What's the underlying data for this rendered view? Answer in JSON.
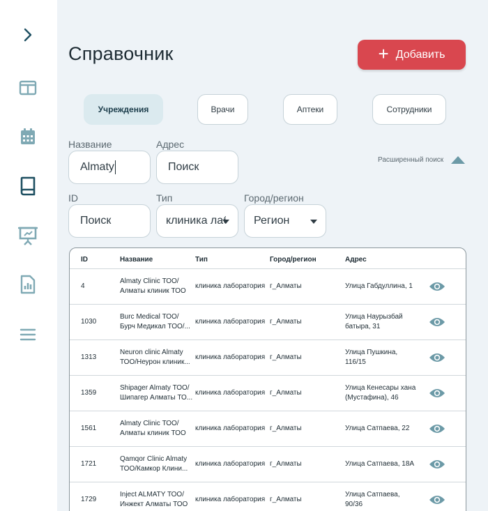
{
  "sidebar": {
    "items": [
      {
        "icon": "chevron-right-icon"
      },
      {
        "icon": "layout-icon"
      },
      {
        "icon": "calendar-icon"
      },
      {
        "icon": "book-icon"
      },
      {
        "icon": "presentation-icon"
      },
      {
        "icon": "report-icon"
      },
      {
        "icon": "menu-icon"
      }
    ]
  },
  "header": {
    "title": "Справочник",
    "add_label": "Добавить"
  },
  "tabs": [
    {
      "label": "Учреждения",
      "active": true
    },
    {
      "label": "Врачи",
      "active": false
    },
    {
      "label": "Аптеки",
      "active": false
    },
    {
      "label": "Сотрудники",
      "active": false
    }
  ],
  "filters": {
    "name": {
      "label": "Название",
      "value": "Almaty"
    },
    "address": {
      "label": "Адрес",
      "placeholder": "Поиск"
    },
    "id": {
      "label": "ID",
      "placeholder": "Поиск"
    },
    "type": {
      "label": "Тип",
      "value": "клиника лаборатория"
    },
    "city": {
      "label": "Город/регион",
      "value": "Регион"
    },
    "advanced_search": "Расширенный поиск"
  },
  "table": {
    "columns": [
      "ID",
      "Название",
      "Тип",
      "Город/регион",
      "Адрес"
    ],
    "rows": [
      {
        "id": "4",
        "name1": "Almaty Clinic ТОО/",
        "name2": "Алматы клиник ТОО",
        "type": "клиника лаборатория",
        "city": "г_Алматы",
        "addr1": "Улица Габдуллина, 1",
        "addr2": ""
      },
      {
        "id": "1030",
        "name1": "Burc Medical ТОО/",
        "name2": "Бурч Медикал ТОО/...",
        "type": "клиника лаборатория",
        "city": "г_Алматы",
        "addr1": "Улица Наурызбай",
        "addr2": "батыра, 31"
      },
      {
        "id": "1313",
        "name1": "Neuron clinic Almaty",
        "name2": "ТОО/Неурон клиник...",
        "type": "клиника лаборатория",
        "city": "г_Алматы",
        "addr1": "Улица Пушкина,",
        "addr2": "116/15"
      },
      {
        "id": "1359",
        "name1": "Shipager Almaty ТОО/",
        "name2": "Шипагер Алматы ТО...",
        "type": "клиника лаборатория",
        "city": "г_Алматы",
        "addr1": "Улица Кенесары хана",
        "addr2": "(Мустафина), 46"
      },
      {
        "id": "1561",
        "name1": "Almaty Clinic ТОО/",
        "name2": "Алматы клиник ТОО",
        "type": "клиника лаборатория",
        "city": "г_Алматы",
        "addr1": "Улица Сатпаева, 22",
        "addr2": ""
      },
      {
        "id": "1721",
        "name1": "Qamqor Clinic Almaty",
        "name2": "ТОО/Камкор Клини...",
        "type": "клиника лаборатория",
        "city": "г_Алматы",
        "addr1": "Улица Сатпаева, 18А",
        "addr2": ""
      },
      {
        "id": "1729",
        "name1": "Inject ALMATY ТОО/",
        "name2": "Инжект Алматы ТОО",
        "type": "клиника лаборатория",
        "city": "г_Алматы",
        "addr1": "Улица Сатпаева,",
        "addr2": "90/36"
      }
    ]
  },
  "colors": {
    "accent": "#d9474f",
    "icon_teal": "#6c9aa7",
    "active_icon": "#1d4f61"
  }
}
